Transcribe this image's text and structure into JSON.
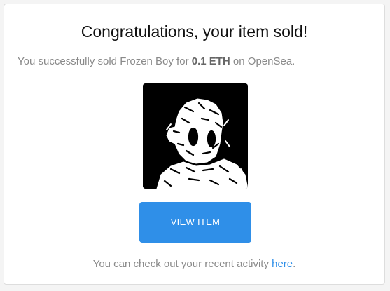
{
  "email": {
    "title": "Congratulations, your item sold!",
    "message": {
      "prefix": "You successfully sold Frozen Boy for ",
      "price": "0.1 ETH",
      "suffix": " on OpenSea."
    },
    "image": {
      "icon": "frozen-boy-nft-artwork"
    },
    "button_label": "VIEW ITEM",
    "footer": {
      "prefix": "You can check out your recent activity ",
      "link_label": "here",
      "suffix": "."
    },
    "colors": {
      "accent": "#2f8fe8",
      "muted_text": "#8a8a8a",
      "title_text": "#111111"
    }
  }
}
